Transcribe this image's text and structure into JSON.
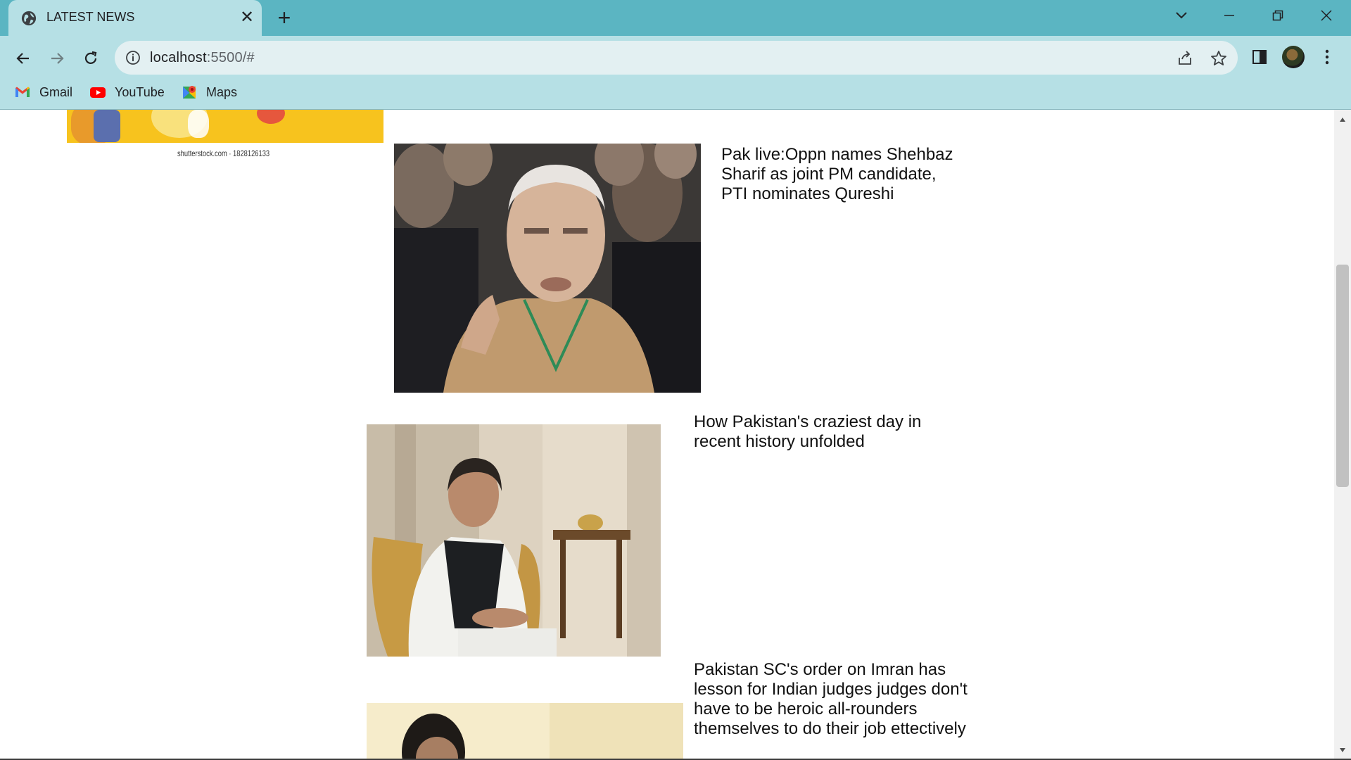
{
  "browser": {
    "tab_title": "LATEST NEWS",
    "tab_close": "✕",
    "new_tab": "+",
    "url_host": "localhost",
    "url_rest": ":5500/#",
    "bookmarks": [
      {
        "label": "Gmail",
        "icon": "gmail-icon"
      },
      {
        "label": "YouTube",
        "icon": "youtube-icon"
      },
      {
        "label": "Maps",
        "icon": "maps-icon"
      }
    ],
    "colors": {
      "titlebar": "#5bb5c2",
      "toolbar": "#b6e0e5",
      "omnibox": "#e3f0f2"
    }
  },
  "page": {
    "top_banner_caption": "shutterstock.com · 1828126133",
    "news": [
      {
        "headline": "Pak live:Oppn names Shehbaz Sharif as joint PM candidate, PTI nominates Qureshi",
        "image": "shehbaz-sharif-photo"
      },
      {
        "headline": "How Pakistan's craziest day in recent history unfolded",
        "image": "imran-khan-seated-photo"
      },
      {
        "headline": "Pakistan SC's order on Imran has lesson for Indian judges judges don't have to be heroic all-rounders themselves to do their job ettectively",
        "image": "imran-khan-photo"
      }
    ]
  }
}
